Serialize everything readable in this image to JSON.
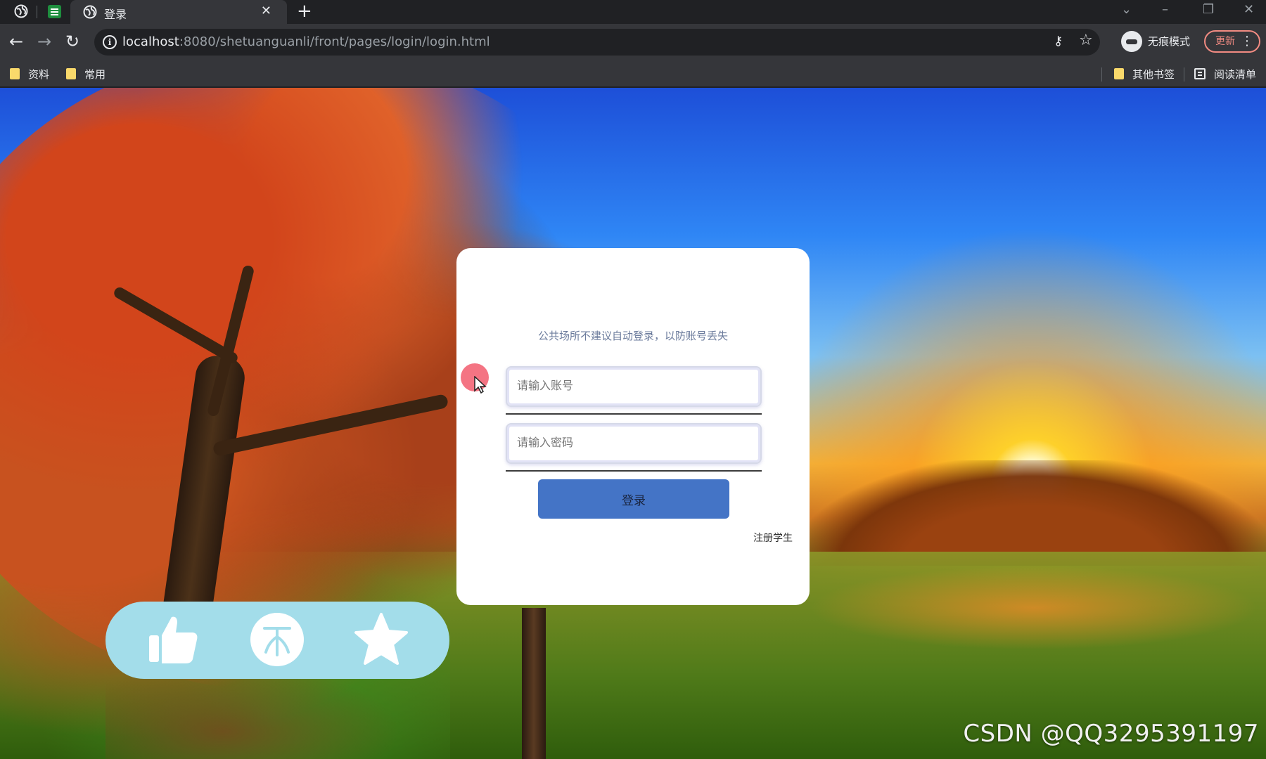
{
  "browser": {
    "tab": {
      "title": "登录"
    },
    "url": {
      "host": "localhost",
      "rest": ":8080/shetuanguanli/front/pages/login/login.html"
    },
    "incognito_label": "无痕模式",
    "update_label": "更新",
    "bookmarks": [
      {
        "label": "资料"
      },
      {
        "label": "常用"
      }
    ],
    "bookmarks_right": {
      "other": "其他书签",
      "reading_list": "阅读清单"
    }
  },
  "login": {
    "tip": "公共场所不建议自动登录，以防账号丢失",
    "username_placeholder": "请输入账号",
    "password_placeholder": "请输入密码",
    "submit_label": "登录",
    "register_label": "注册学生"
  },
  "actions": [
    {
      "icon": "thumbs-up-icon"
    },
    {
      "icon": "coin-icon"
    },
    {
      "icon": "star-icon"
    }
  ],
  "watermark": "CSDN @QQ3295391197",
  "colors": {
    "card": "#ffffff",
    "button": "#4474c6",
    "action_bar": "#a3ddea",
    "update": "#f28b82"
  }
}
